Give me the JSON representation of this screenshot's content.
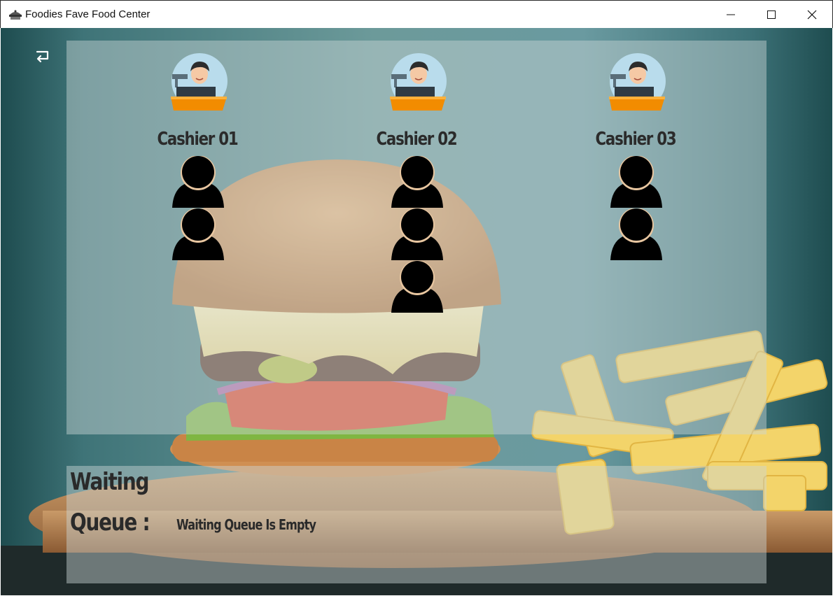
{
  "window": {
    "title": "Foodies Fave Food Center",
    "controls": [
      "minimize-icon",
      "maximize-icon",
      "close-icon"
    ]
  },
  "back_button": {
    "icon": "return-arrow-icon"
  },
  "cashiers": [
    {
      "label": "Cashier 01",
      "customers_in_queue": 2
    },
    {
      "label": "Cashier 02",
      "customers_in_queue": 3
    },
    {
      "label": "Cashier 03",
      "customers_in_queue": 2
    }
  ],
  "waiting_queue": {
    "title_line1": "Waiting",
    "title_line2": "Queue :",
    "status": "Waiting Queue Is Empty"
  },
  "colors": {
    "panel_overlay": "#cdd7d7",
    "text_dark": "#2a2a2a",
    "customer_icon": "#000000",
    "cashier_counter": "#f28c00",
    "cashier_shirt": "#1f9a8a"
  }
}
